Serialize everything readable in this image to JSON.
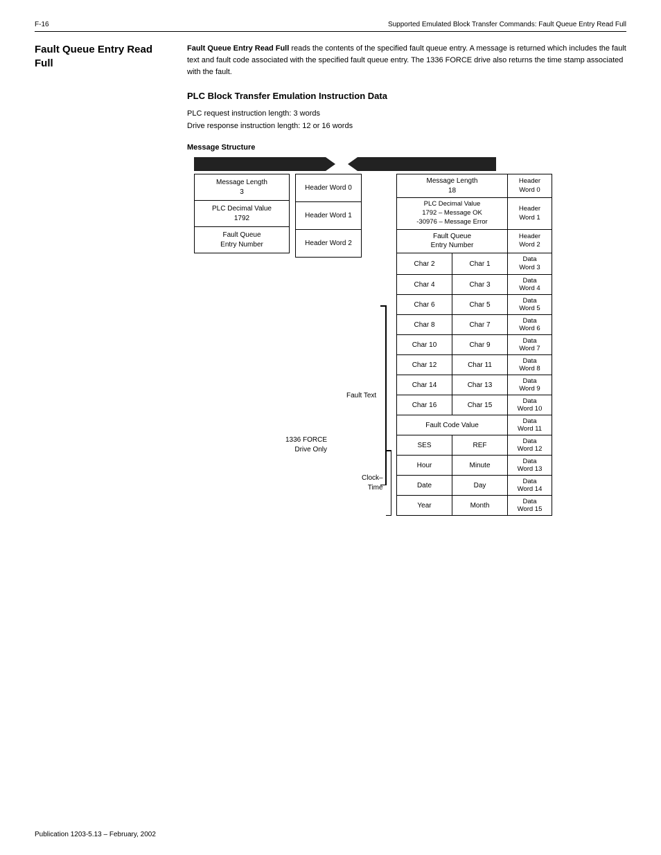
{
  "header": {
    "left": "F-16",
    "right": "Supported Emulated Block Transfer Commands: Fault Queue Entry Read Full"
  },
  "section": {
    "title": "Fault Queue Entry Read Full",
    "intro_bold": "Fault Queue Entry Read Full",
    "intro_rest": " reads the contents of the specified fault queue entry. A message is returned which includes the fault text and fault code associated with the specified fault queue entry. The 1336 FORCE drive also returns the time stamp associated with the fault.",
    "sub_heading": "PLC Block Transfer Emulation Instruction Data",
    "plc_line1": "PLC request instruction length: 3 words",
    "plc_line2": "Drive response instruction length: 12 or 16 words",
    "msg_structure_label": "Message Structure"
  },
  "request_table": {
    "rows": [
      {
        "text": "Message Length\n3"
      },
      {
        "text": "PLC Decimal Value\n1792"
      },
      {
        "text": "Fault Queue\nEntry Number"
      }
    ]
  },
  "header_words_left": [
    {
      "text": "Header Word 0"
    },
    {
      "text": "Header Word 1"
    },
    {
      "text": "Header Word 2"
    }
  ],
  "response_table": {
    "header_rows": [
      {
        "left": "Message Length\n18",
        "right": "Header\nWord 0"
      },
      {
        "left": "PLC Decimal Value\n1792 – Message OK\n-30976 – Message Error",
        "right": "Header\nWord 1"
      },
      {
        "left": "Fault Queue\nEntry Number",
        "right": "Header\nWord 2"
      }
    ],
    "data_rows": [
      {
        "col1": "Char 2",
        "col2": "Char 1",
        "right": "Data\nWord 3"
      },
      {
        "col1": "Char 4",
        "col2": "Char 3",
        "right": "Data\nWord 4"
      },
      {
        "col1": "Char 6",
        "col2": "Char 5",
        "right": "Data\nWord 5"
      },
      {
        "col1": "Char 8",
        "col2": "Char 7",
        "right": "Data\nWord 6"
      },
      {
        "col1": "Char 10",
        "col2": "Char 9",
        "right": "Data\nWord 7"
      },
      {
        "col1": "Char 12",
        "col2": "Char 11",
        "right": "Data\nWord 8"
      },
      {
        "col1": "Char 14",
        "col2": "Char 13",
        "right": "Data\nWord 9"
      },
      {
        "col1": "Char 16",
        "col2": "Char 15",
        "right": "Data\nWord 10"
      }
    ],
    "fault_code_row": {
      "text": "Fault Code Value",
      "right": "Data\nWord 11"
    },
    "ses_ref_row": {
      "col1": "SES",
      "col2": "REF",
      "right": "Data\nWord 12"
    },
    "clock_rows": [
      {
        "col1": "Hour",
        "col2": "Minute",
        "right": "Data\nWord 13"
      },
      {
        "col1": "Date",
        "col2": "Day",
        "right": "Data\nWord 14"
      },
      {
        "col1": "Year",
        "col2": "Month",
        "right": "Data\nWord 15"
      }
    ]
  },
  "labels": {
    "fault_text": "Fault Text",
    "clock_time": "Clock–\nTime",
    "force_drive": "1336  FORCE\nDrive Only"
  },
  "footer": {
    "text": "Publication 1203-5.13 – February, 2002"
  }
}
